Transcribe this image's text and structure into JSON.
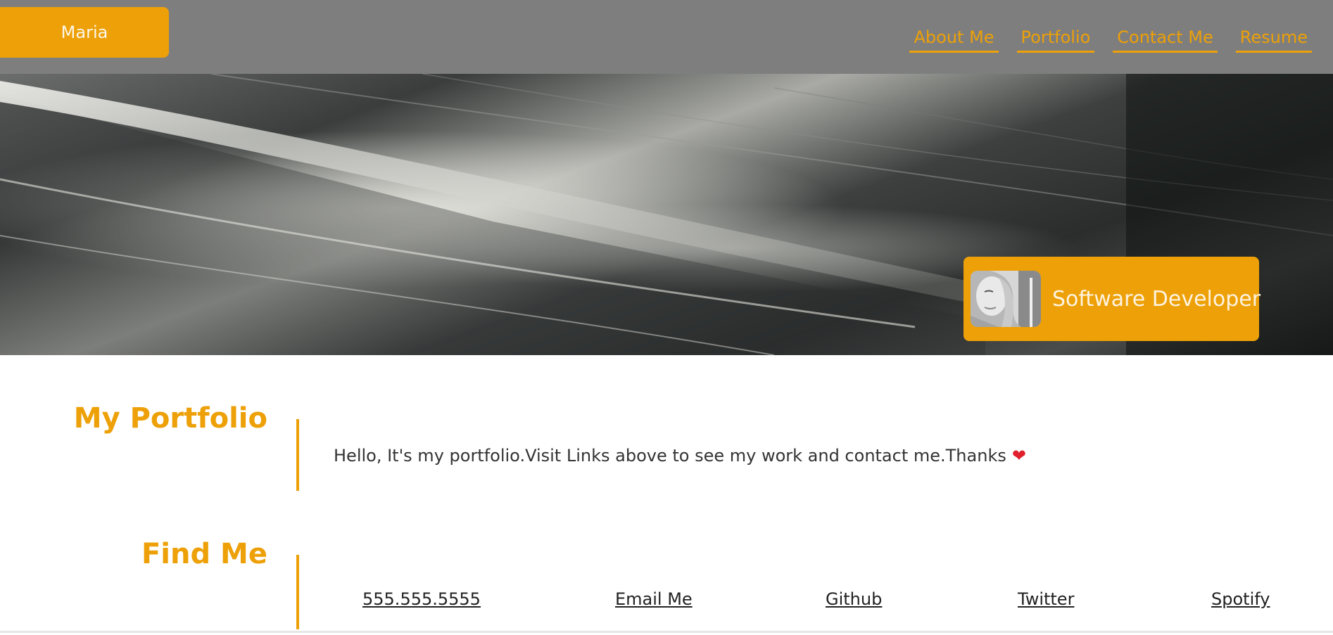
{
  "header": {
    "brand": "Maria",
    "nav": [
      {
        "label": "About Me"
      },
      {
        "label": "Portfolio"
      },
      {
        "label": "Contact Me"
      },
      {
        "label": "Resume"
      }
    ]
  },
  "hero": {
    "role": "Software Developer"
  },
  "portfolio": {
    "heading": "My Portfolio",
    "text": "Hello, It's my portfolio.Visit Links above to see my work and contact me.Thanks"
  },
  "find_me": {
    "heading": "Find Me",
    "links": [
      {
        "label": "555.555.5555"
      },
      {
        "label": "Email Me"
      },
      {
        "label": "Github"
      },
      {
        "label": "Twitter"
      },
      {
        "label": "Spotify"
      }
    ]
  },
  "colors": {
    "accent": "#eda007",
    "header_bg": "#7e7e7e",
    "heart": "#e0202c"
  },
  "icons": {
    "heart": "heart-icon",
    "avatar": "profile-photo"
  }
}
